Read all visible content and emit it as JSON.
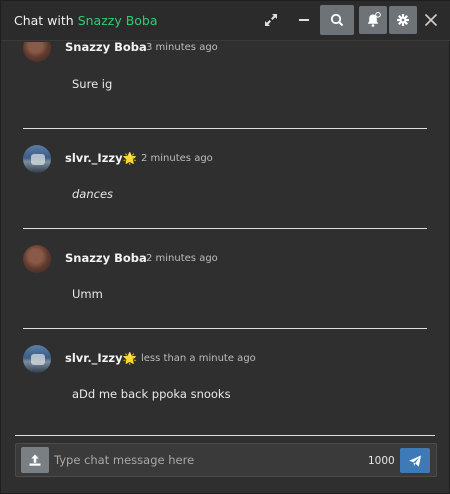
{
  "header": {
    "title_prefix": "Chat with ",
    "title_name": "Snazzy Boba"
  },
  "messages": [
    {
      "author": "Snazzy Boba",
      "time": "3 minutes ago",
      "text": "Sure ig",
      "avatar": "boba"
    },
    {
      "author": "slvr._Izzy",
      "author_emoji": "🌟",
      "time": "2 minutes ago",
      "text": "dances",
      "avatar": "izzy",
      "italic": true
    },
    {
      "author": "Snazzy Boba",
      "time": "2 minutes ago",
      "text": "Umm",
      "avatar": "boba"
    },
    {
      "author": "slvr._Izzy",
      "author_emoji": "🌟",
      "time": "less than a minute ago",
      "text": "aDd me back ppoka snooks",
      "avatar": "izzy"
    }
  ],
  "composer": {
    "placeholder": "Type chat message here",
    "value": "",
    "char_counter": "1000"
  },
  "colors": {
    "accent_name": "#2ecc71",
    "send_button": "#3d7ab7"
  },
  "icons": {
    "expand": "expand-icon",
    "minimize": "minimize-icon",
    "search": "search-icon",
    "notification": "bell-icon",
    "settings": "gear-icon",
    "close": "close-icon",
    "upload": "upload-icon",
    "send": "send-icon"
  }
}
